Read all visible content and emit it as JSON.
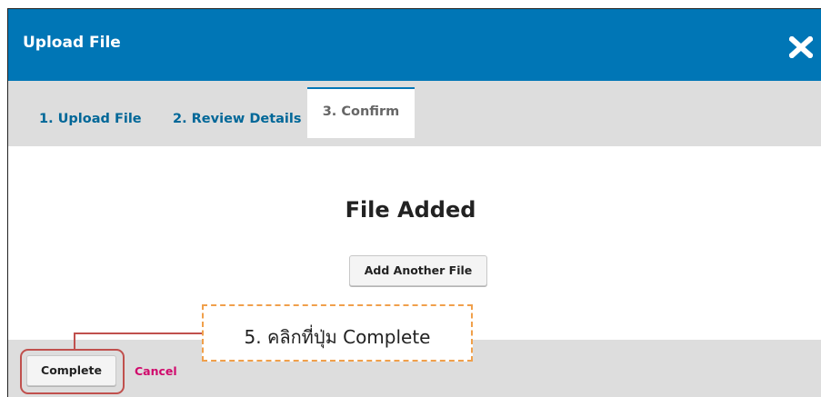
{
  "dialog": {
    "title": "Upload File",
    "close_icon": "close-icon"
  },
  "tabs": [
    {
      "label": "1. Upload File",
      "active": false
    },
    {
      "label": "2. Review Details",
      "active": false
    },
    {
      "label": "3. Confirm",
      "active": true
    }
  ],
  "content": {
    "heading": "File Added",
    "add_another_label": "Add Another File"
  },
  "footer": {
    "complete_label": "Complete",
    "cancel_label": "Cancel"
  },
  "annotation": {
    "callout_text": "5. คลิกที่ปุ่ม Complete"
  },
  "colors": {
    "header": "#0076b6",
    "tab_text": "#006798",
    "cancel": "#d00a6c",
    "highlight": "#c0504d",
    "callout_border": "#f0a04b"
  }
}
